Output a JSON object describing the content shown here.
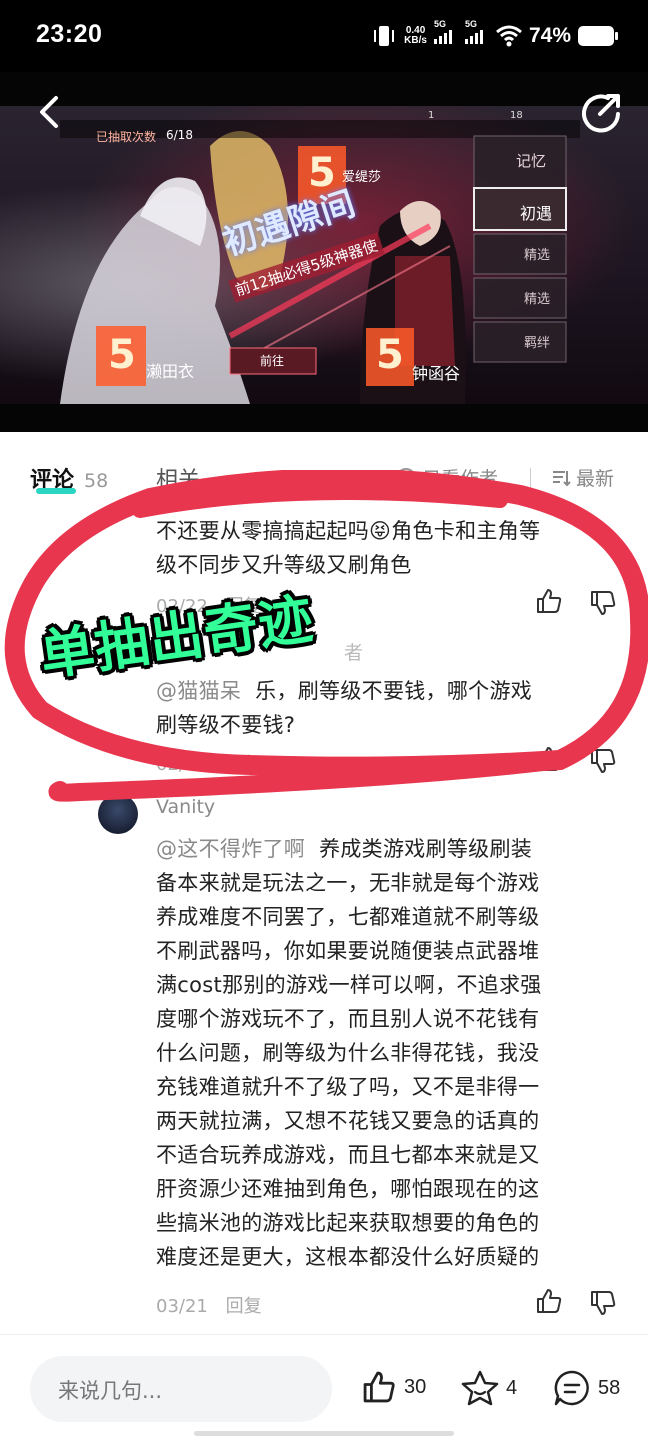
{
  "status_bar": {
    "time": "23:20",
    "net_speed_value": "0.40",
    "net_speed_unit": "KB/s",
    "signal1_label": "5G",
    "signal2_label": "5G",
    "battery": "74%"
  },
  "icons": {
    "back": "back-arrow-icon",
    "share": "share-icon",
    "like": "thumbs-up-icon",
    "dislike": "thumbs-down-icon",
    "favorite": "star-icon",
    "comment": "comment-bubble-icon",
    "sort": "sort-lines-icon"
  },
  "banner": {
    "top_left_label": "已抽取次数",
    "top_left_count": "6/18",
    "event_title": "初遇隙间",
    "event_subtitle": "前12抽必得5级神器使",
    "char1_grade": "5",
    "char1_name": "濑田衣",
    "char2_grade": "5",
    "char2_name": "爱缇莎",
    "char3_grade": "5",
    "char3_name": "钟函谷",
    "goto_button": "前往",
    "side_tabs": [
      "记忆",
      "初遇",
      "精选",
      "精选",
      "羁绊"
    ],
    "currency1": "1",
    "currency2": "18"
  },
  "tabs": {
    "comments_label": "评论",
    "comments_count": "58",
    "related_label": "相关",
    "author_only": "只看作者",
    "sort_label": "最新"
  },
  "comments": [
    {
      "text_line1": "不还要从零搞搞起起吗😝角色卡和主角等",
      "text_line2": "级不同步又升等级又刷角色",
      "date": "02/22",
      "reply": "回复"
    },
    {
      "partial_name": "者",
      "mention": "@猫猫呆",
      "text_line1": "乐，刷等级不要钱，哪个游戏",
      "text_line2": "刷等级不要钱?",
      "date": "02/22",
      "reply": "回复"
    },
    {
      "username": "Vanity",
      "mention": "@这不得炸了啊",
      "first_line_rest": "养成类游戏刷等级刷装",
      "lines": [
        "备本来就是玩法之一，无非就是每个游戏",
        "养成难度不同罢了，七都难道就不刷等级",
        "不刷武器吗，你如果要说随便装点武器堆",
        "满cost那别的游戏一样可以啊，不追求强",
        "度哪个游戏玩不了，而且别人说不花钱有",
        "什么问题，刷等级为什么非得花钱，我没",
        "充钱难道就升不了级了吗，又不是非得一",
        "两天就拉满，又想不花钱又要急的话真的",
        "不适合玩养成游戏，而且七都本来就是又",
        "肝资源少还难抽到角色，哪怕跟现在的这",
        "些搞米池的游戏比起来获取想要的角色的",
        "难度还是更大，这根本都没什么好质疑的"
      ],
      "date": "03/21",
      "reply": "回复"
    }
  ],
  "overlay": {
    "caption": "单抽出奇迹",
    "loop_color": "#e8364f",
    "caption_color": "#33ff99"
  },
  "bottom_bar": {
    "input_placeholder": "来说几句...",
    "like_count": "30",
    "favorite_count": "4",
    "comment_count": "58"
  },
  "colors": {
    "accent": "#2ad5c4",
    "text_primary": "#222222",
    "text_secondary": "#8a8a8a"
  }
}
